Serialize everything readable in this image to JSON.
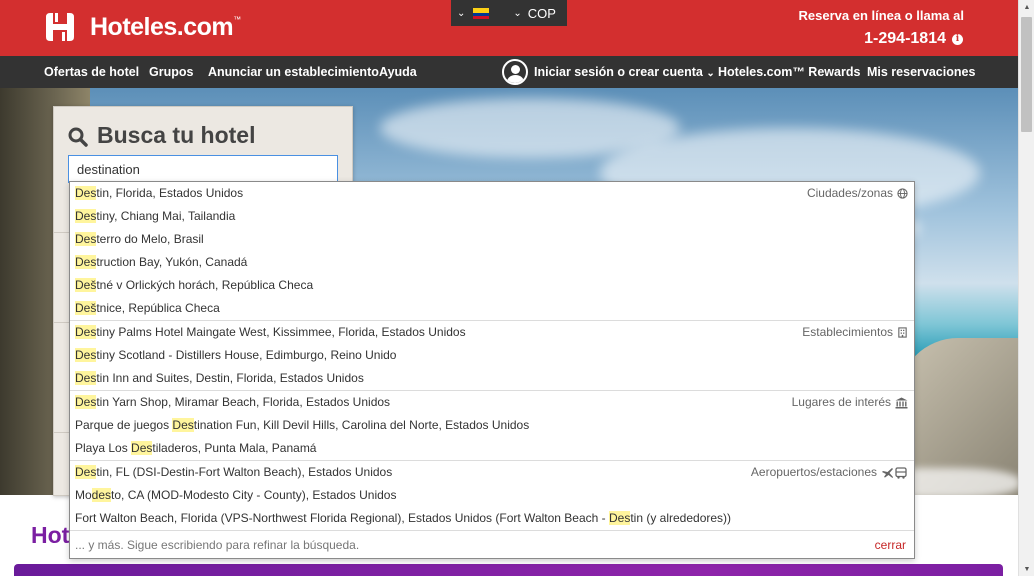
{
  "header": {
    "brand": "Hoteles.com",
    "brand_tm": "™",
    "locale_country": "Colombia",
    "currency": "COP",
    "reserve_text": "Reserva en línea o llama al",
    "phone": "1-294-1814",
    "info_glyph": "i"
  },
  "nav": {
    "left_items": [
      "Ofertas de hotel",
      "Grupos",
      "Anunciar un establecimiento",
      "Ayuda"
    ],
    "sign_in": "Iniciar sesión o crear cuenta",
    "rewards": "Hoteles.com™ Rewards",
    "reservations": "Mis reservaciones"
  },
  "search": {
    "title": "Busca tu hotel",
    "destination_value": "destination"
  },
  "autocomplete": {
    "groups": [
      {
        "category": "Ciudades/zonas",
        "icon": "globe-icon",
        "items": [
          {
            "hl": "Des",
            "rest": "tin, Florida, Estados Unidos"
          },
          {
            "hl": "Des",
            "rest": "tiny, Chiang Mai, Tailandia"
          },
          {
            "hl": "Des",
            "rest": "terro do Melo, Brasil"
          },
          {
            "hl": "Des",
            "rest": "truction Bay, Yukón, Canadá"
          },
          {
            "hl": "Deš",
            "rest": "tné v Orlických horách, República Checa"
          },
          {
            "hl": "Deš",
            "rest": "tnice, República Checa"
          }
        ]
      },
      {
        "category": "Establecimientos",
        "icon": "building-icon",
        "items": [
          {
            "hl": "Des",
            "rest": "tiny Palms Hotel Maingate West, Kissimmee, Florida, Estados Unidos"
          },
          {
            "hl": "Des",
            "rest": "tiny Scotland - Distillers House, Edimburgo, Reino Unido"
          },
          {
            "hl": "Des",
            "rest": "tin Inn and Suites, Destin, Florida, Estados Unidos"
          }
        ]
      },
      {
        "category": "Lugares de interés",
        "icon": "landmark-icon",
        "items": [
          {
            "hl": "Des",
            "rest": "tin Yarn Shop, Miramar Beach, Florida, Estados Unidos"
          },
          {
            "pre": "Parque de juegos ",
            "hl": "Des",
            "rest": "tination Fun, Kill Devil Hills, Carolina del Norte, Estados Unidos"
          },
          {
            "pre": "Playa Los ",
            "hl": "Des",
            "rest": "tiladeros, Punta Mala, Panamá"
          }
        ]
      },
      {
        "category": "Aeropuertos/estaciones",
        "icon": "plane-bus-icon",
        "items": [
          {
            "hl": "Des",
            "rest": "tin, FL (DSI-Destin-Fort Walton Beach), Estados Unidos"
          },
          {
            "pre": "Mo",
            "hl": "des",
            "rest": "to, CA (MOD-Modesto City - County), Estados Unidos"
          },
          {
            "pre": "Fort Walton Beach, Florida (VPS-Northwest Florida Regional), Estados Unidos (Fort Walton Beach - ",
            "hl": "Des",
            "rest": "tin (y alrededores))"
          }
        ]
      }
    ],
    "footer_text": "... y más. Sigue escribiendo para refinar la búsqueda.",
    "close_label": "cerrar"
  },
  "below": {
    "title_partial": "Hot"
  },
  "colors": {
    "brand_red": "#d32f2f",
    "nav_dark": "#333333",
    "highlight": "#fff59d",
    "purple": "#7b1fa2"
  }
}
